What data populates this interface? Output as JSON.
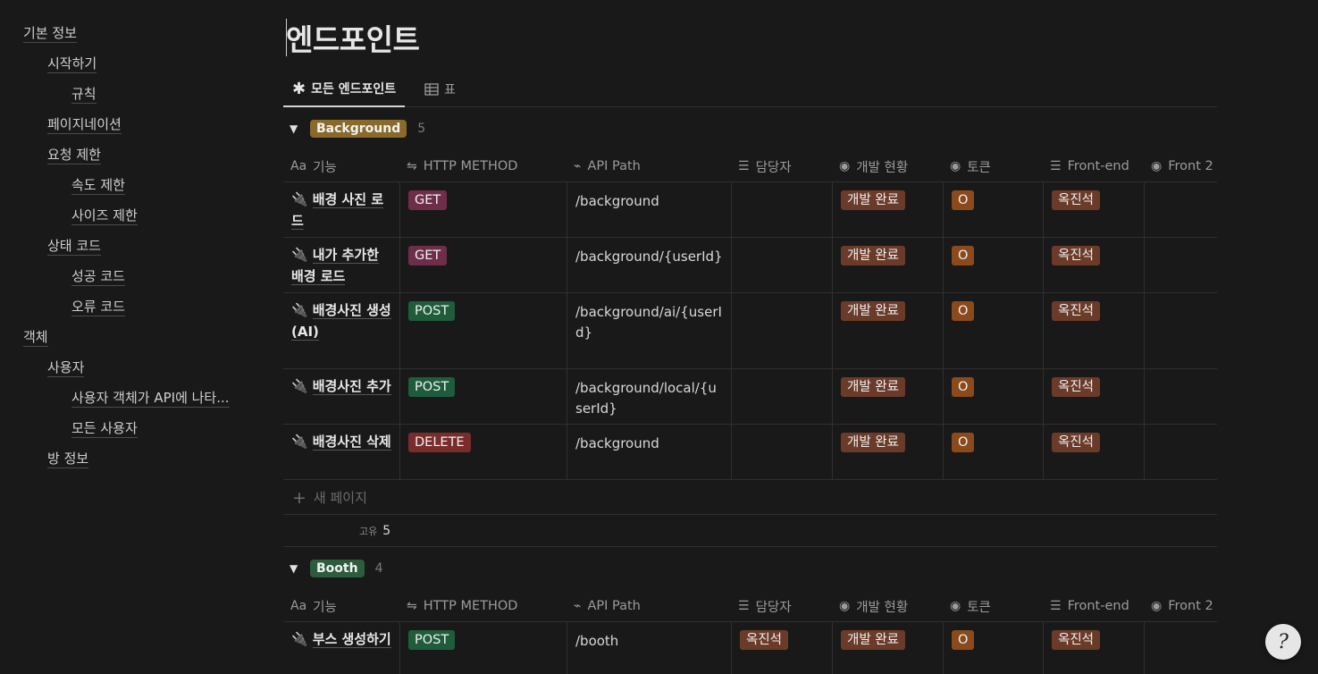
{
  "toc": [
    {
      "label": "기본 정보",
      "level": 1
    },
    {
      "label": "시작하기",
      "level": 2
    },
    {
      "label": "규칙",
      "level": 3
    },
    {
      "label": "페이지네이션",
      "level": 2
    },
    {
      "label": "요청 제한",
      "level": 2
    },
    {
      "label": "속도 제한",
      "level": 3
    },
    {
      "label": "사이즈 제한",
      "level": 3
    },
    {
      "label": "상태 코드",
      "level": 2
    },
    {
      "label": "성공 코드",
      "level": 3
    },
    {
      "label": "오류 코드",
      "level": 3
    },
    {
      "label": "객체",
      "level": 1
    },
    {
      "label": "사용자",
      "level": 2
    },
    {
      "label": "사용자 객체가 API에 나타...",
      "level": 3
    },
    {
      "label": "모든 사용자",
      "level": 3
    },
    {
      "label": "방 정보",
      "level": 2
    }
  ],
  "page": {
    "title": "엔드포인트"
  },
  "tabs": {
    "active": {
      "label": "모든 엔드포인트",
      "icon": "asterisk-icon"
    },
    "table": {
      "label": "표",
      "icon": "table-icon"
    }
  },
  "columns": {
    "name": {
      "label": "기능",
      "icon": "Aa"
    },
    "method": {
      "label": "HTTP METHOD",
      "icon": "relation-icon"
    },
    "path": {
      "label": "API Path",
      "icon": "link-icon"
    },
    "owner": {
      "label": "담당자",
      "icon": "list-icon"
    },
    "status": {
      "label": "개발 현황",
      "icon": "status-icon"
    },
    "token": {
      "label": "토큰",
      "icon": "status-icon"
    },
    "frontend": {
      "label": "Front-end",
      "icon": "list-icon"
    },
    "front2": {
      "label": "Front 2",
      "icon": "status-icon"
    }
  },
  "groups": [
    {
      "tag": "Background",
      "tag_color": "#8a6a2a",
      "count": "5",
      "rows": [
        {
          "name": "배경 사진 로드",
          "method": "GET",
          "method_kind": "get",
          "path": "/background",
          "owner": "",
          "status": "개발 완료",
          "token": "O",
          "frontend": "옥진석"
        },
        {
          "name": "내가 추가한 배경 로드",
          "method": "GET",
          "method_kind": "get",
          "path": "/background/{userId}",
          "owner": "",
          "status": "개발 완료",
          "token": "O",
          "frontend": "옥진석"
        },
        {
          "name": "배경사진 생성(AI)",
          "method": "POST",
          "method_kind": "post",
          "path": "/background/ai/{userId}",
          "owner": "",
          "status": "개발 완료",
          "token": "O",
          "frontend": "옥진석"
        },
        {
          "name": "배경사진 추가",
          "method": "POST",
          "method_kind": "post",
          "path": "/background/local/{userId}",
          "owner": "",
          "status": "개발 완료",
          "token": "O",
          "frontend": "옥진석"
        },
        {
          "name": "배경사진 삭제",
          "method": "DELETE",
          "method_kind": "delete",
          "path": "/background",
          "owner": "",
          "status": "개발 완료",
          "token": "O",
          "frontend": "옥진석"
        }
      ],
      "new_page": "새 페이지",
      "summary_label": "고유",
      "summary_value": "5"
    },
    {
      "tag": "Booth",
      "tag_color": "#2c5c3c",
      "count": "4",
      "rows": [
        {
          "name": "부스 생성하기",
          "method": "POST",
          "method_kind": "post",
          "path": "/booth",
          "owner": "옥진석",
          "status": "개발 완료",
          "token": "O",
          "frontend": "옥진석"
        }
      ]
    }
  ],
  "help_button": {
    "label": "?"
  }
}
